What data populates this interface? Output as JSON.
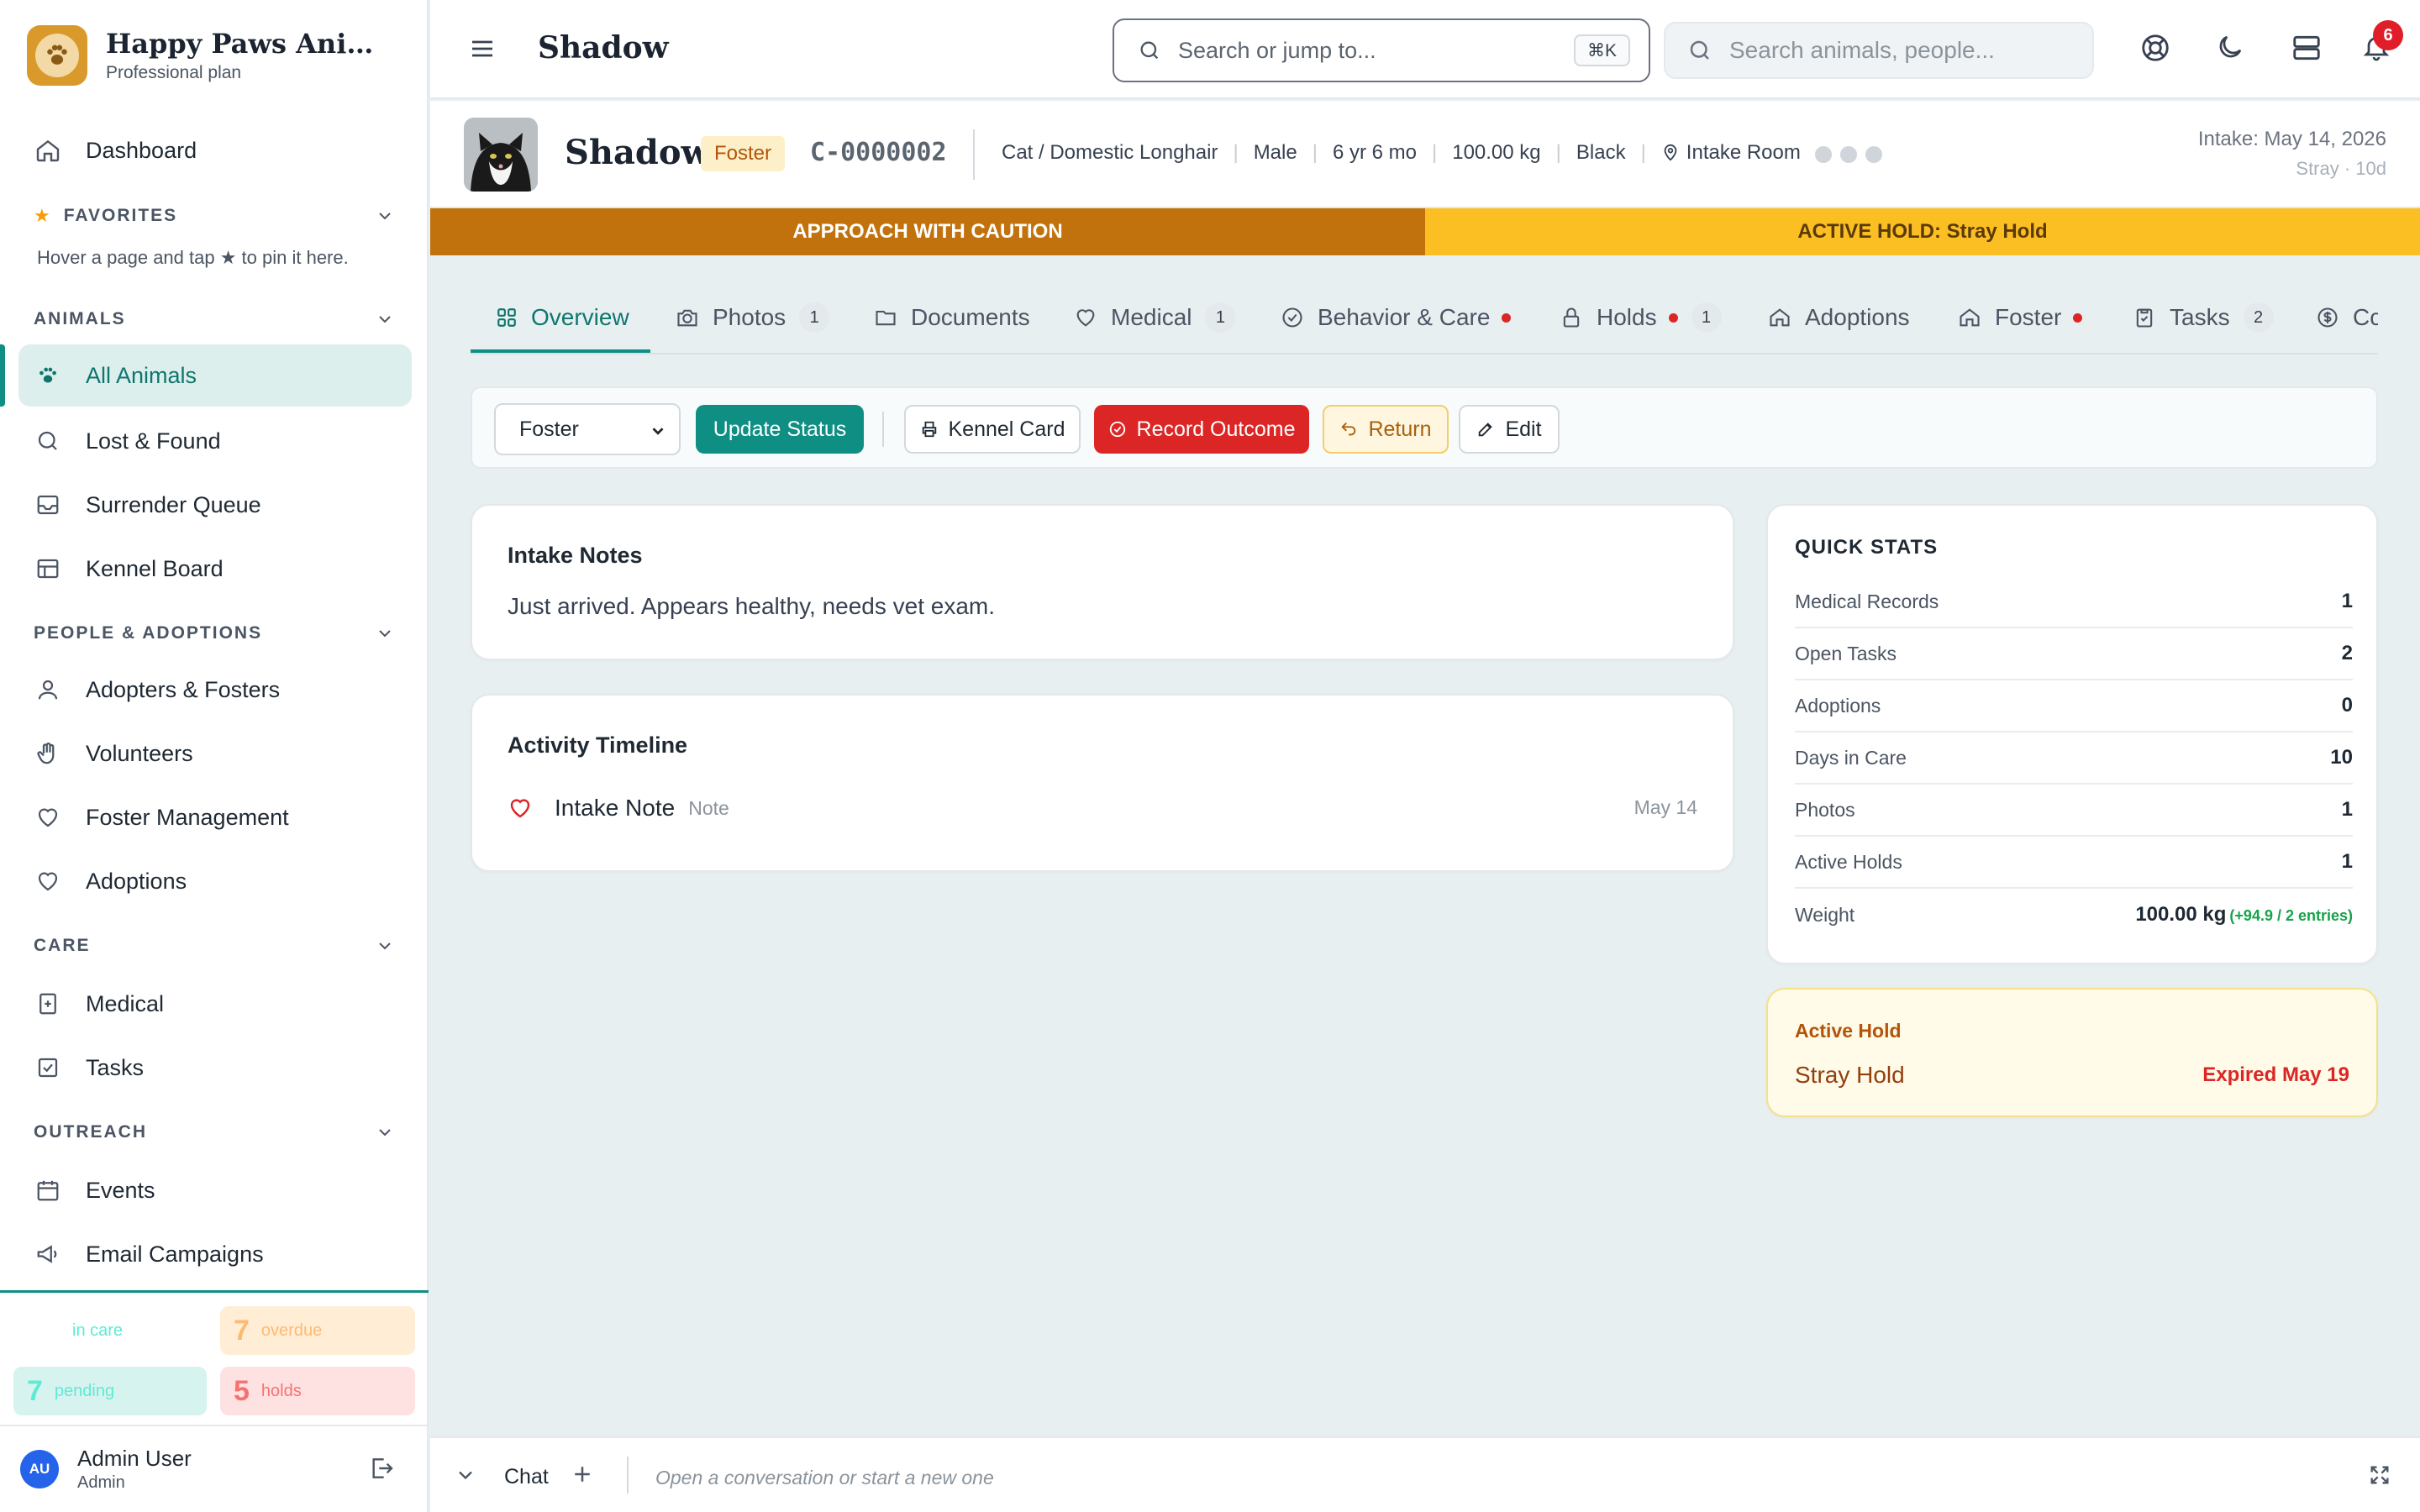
{
  "brand": {
    "name": "Happy Paws Animal ...",
    "plan": "Professional plan"
  },
  "sidebar": {
    "dashboard": "Dashboard",
    "favorites_label": "FAVORITES",
    "favorites_hint": "Hover a page and tap ★ to pin it here.",
    "sections": {
      "animals": "ANIMALS",
      "people": "PEOPLE & ADOPTIONS",
      "care": "CARE",
      "outreach": "OUTREACH"
    },
    "items": {
      "all_animals": "All Animals",
      "lost_found": "Lost & Found",
      "surrender_queue": "Surrender Queue",
      "kennel_board": "Kennel Board",
      "adopters_fosters": "Adopters & Fosters",
      "volunteers": "Volunteers",
      "foster_management": "Foster Management",
      "adoptions": "Adoptions",
      "medical": "Medical",
      "tasks": "Tasks",
      "events": "Events",
      "email_campaigns": "Email Campaigns"
    },
    "stats": {
      "in_care_label": "in care",
      "overdue_count": "7",
      "overdue_label": "overdue",
      "pending_count": "7",
      "pending_label": "pending",
      "holds_count": "5",
      "holds_label": "holds"
    },
    "user": {
      "initials": "AU",
      "name": "Admin User",
      "role": "Admin"
    }
  },
  "topbar": {
    "title": "Shadow",
    "jump_placeholder": "Search or jump to...",
    "shortcut": "⌘K",
    "search_placeholder": "Search animals, people...",
    "notification_count": "6"
  },
  "animal": {
    "name": "Shadow",
    "status": "Foster",
    "id": "C-0000002",
    "species_breed": "Cat / Domestic Longhair",
    "sex": "Male",
    "age": "6 yr 6 mo",
    "weight": "100.00 kg",
    "color": "Black",
    "location": "Intake Room",
    "intake_date": "Intake: May 14, 2026",
    "intake_sub": "Stray · 10d"
  },
  "banners": {
    "caution": "APPROACH WITH CAUTION",
    "hold": "ACTIVE HOLD: Stray Hold"
  },
  "tabs": [
    {
      "label": "Overview"
    },
    {
      "label": "Photos",
      "count": "1"
    },
    {
      "label": "Documents"
    },
    {
      "label": "Medical",
      "count": "1"
    },
    {
      "label": "Behavior & Care"
    },
    {
      "label": "Holds",
      "count": "1"
    },
    {
      "label": "Adoptions"
    },
    {
      "label": "Foster"
    },
    {
      "label": "Tasks",
      "count": "2"
    },
    {
      "label": "Cc"
    }
  ],
  "actions": {
    "status_value": "Foster",
    "update_status": "Update Status",
    "kennel_card": "Kennel Card",
    "record_outcome": "Record Outcome",
    "return": "Return",
    "edit": "Edit"
  },
  "intake_notes": {
    "title": "Intake Notes",
    "text": "Just arrived. Appears healthy, needs vet exam."
  },
  "timeline": {
    "title": "Activity Timeline",
    "items": [
      {
        "title": "Intake Note",
        "type": "Note",
        "date": "May 14"
      }
    ]
  },
  "quick_stats": {
    "title": "QUICK STATS",
    "rows": [
      {
        "label": "Medical Records",
        "value": "1"
      },
      {
        "label": "Open Tasks",
        "value": "2"
      },
      {
        "label": "Adoptions",
        "value": "0"
      },
      {
        "label": "Days in Care",
        "value": "10"
      },
      {
        "label": "Photos",
        "value": "1"
      },
      {
        "label": "Active Holds",
        "value": "1"
      },
      {
        "label": "Weight",
        "value": "100.00 kg",
        "delta": "(+94.9 / 2 entries)"
      }
    ]
  },
  "active_hold": {
    "label": "Active Hold",
    "name": "Stray Hold",
    "expiry": "Expired May 19"
  },
  "chat": {
    "label": "Chat",
    "placeholder": "Open a conversation or start a new one"
  },
  "colors": {
    "accent": "#0f8f83",
    "caution": "#c2720c",
    "hold": "#fbbf24",
    "danger": "#dc2626"
  }
}
